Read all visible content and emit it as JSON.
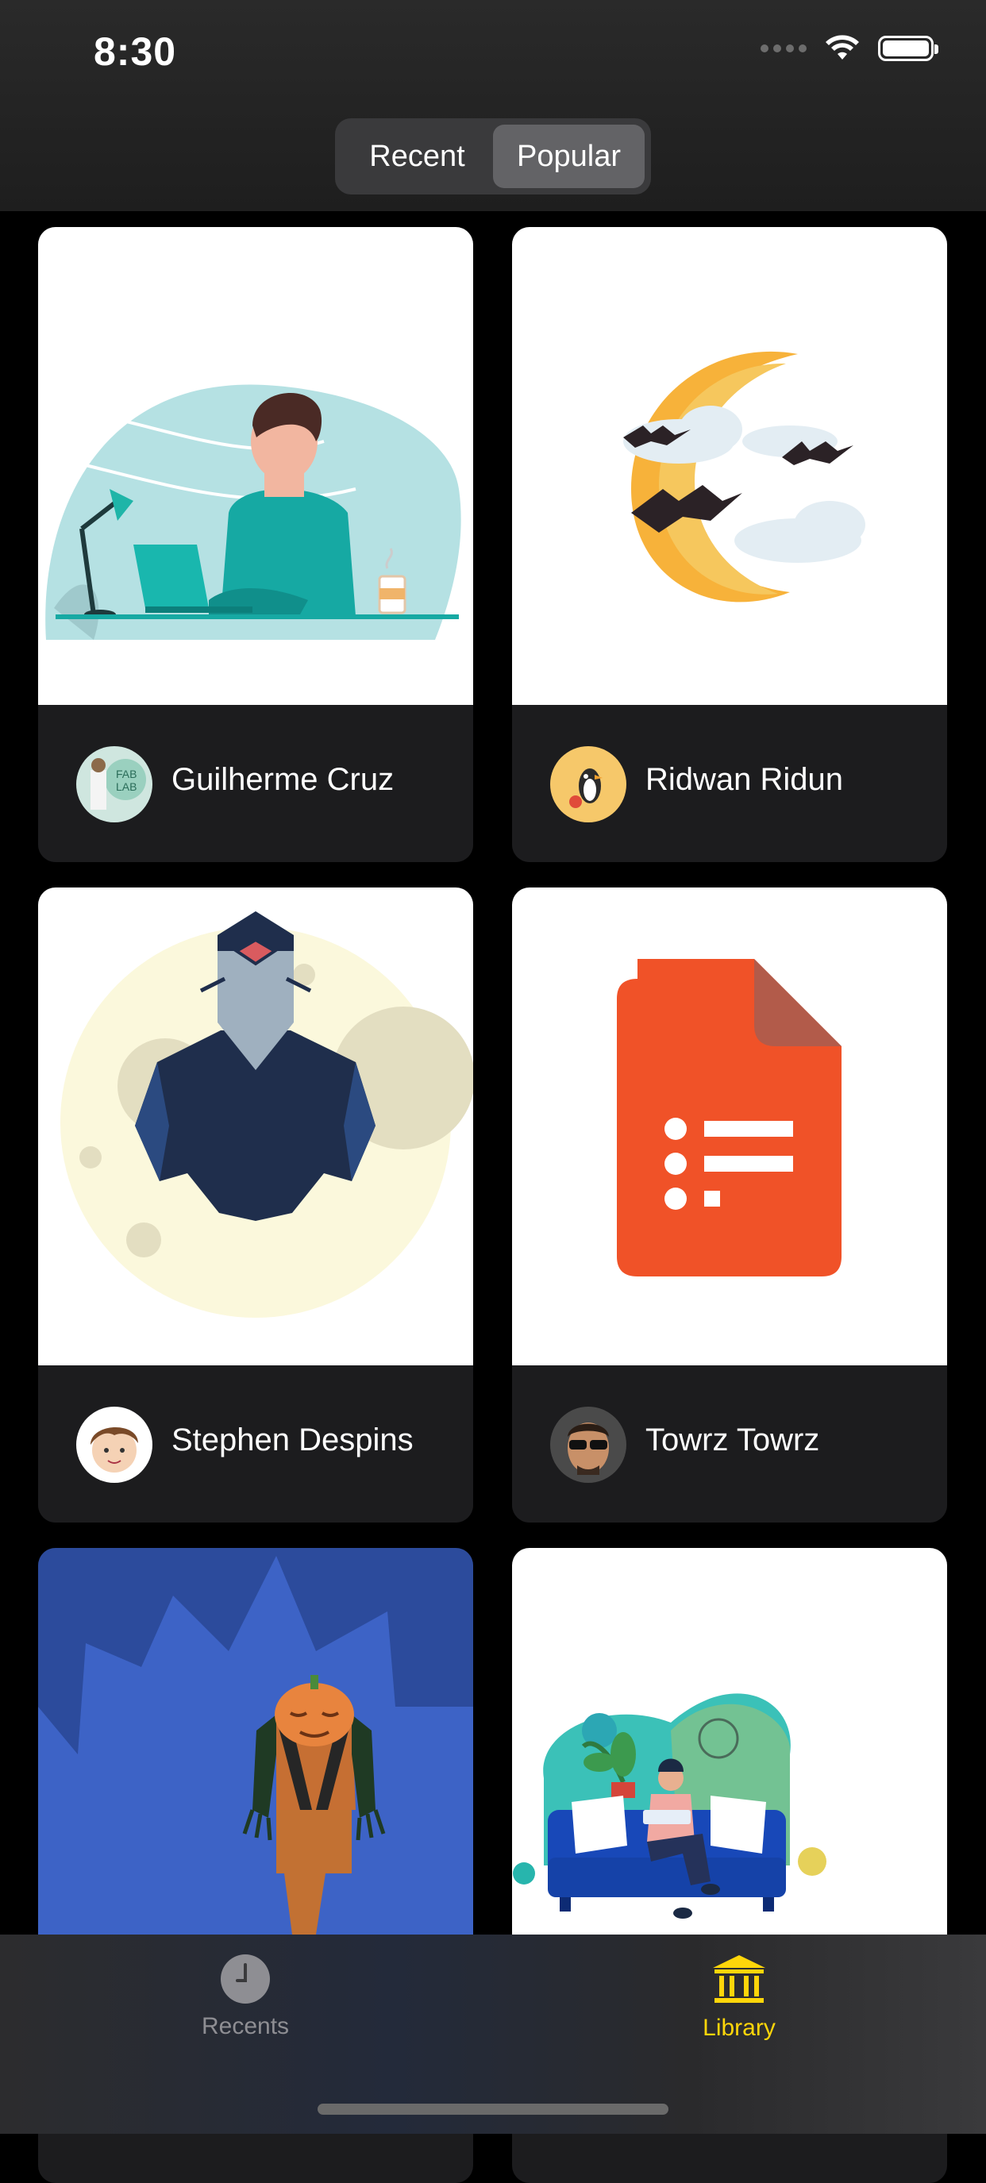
{
  "status_bar": {
    "time": "8:30"
  },
  "segmented": {
    "items": [
      {
        "label": "Recent"
      },
      {
        "label": "Popular"
      }
    ],
    "selected": "Popular"
  },
  "cards": [
    {
      "author": "Guilherme Cruz"
    },
    {
      "author": "Ridwan Ridun"
    },
    {
      "author": "Stephen Despins"
    },
    {
      "author": "Towrz Towrz"
    },
    {
      "author": ""
    },
    {
      "author": ""
    }
  ],
  "tabbar": {
    "items": [
      {
        "label": "Recents",
        "icon": "clock-icon"
      },
      {
        "label": "Library",
        "icon": "bank-icon"
      }
    ],
    "selected": "Library",
    "accent": "#ffd60a",
    "inactive": "#8e8e93"
  }
}
